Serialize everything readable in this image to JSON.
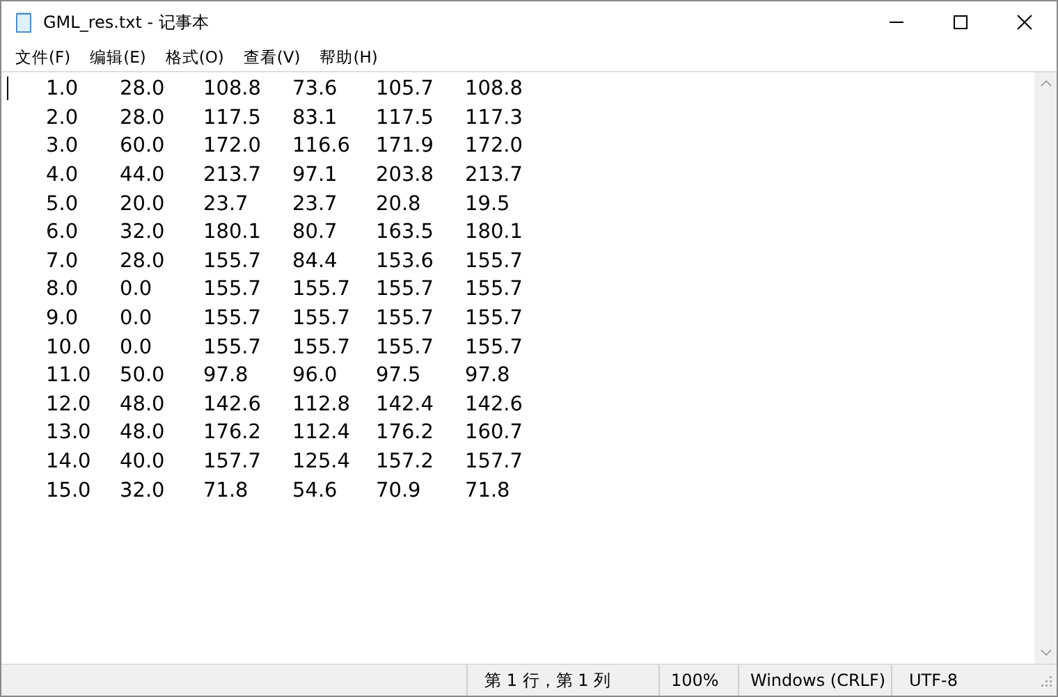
{
  "window": {
    "title": "GML_res.txt - 记事本"
  },
  "menu": [
    "文件(F)",
    "编辑(E)",
    "格式(O)",
    "查看(V)",
    "帮助(H)"
  ],
  "rows": [
    [
      "1.0",
      "28.0",
      "108.8",
      "73.6",
      "105.7",
      "108.8"
    ],
    [
      "2.0",
      "28.0",
      "117.5",
      "83.1",
      "117.5",
      "117.3"
    ],
    [
      "3.0",
      "60.0",
      "172.0",
      "116.6",
      "171.9",
      "172.0"
    ],
    [
      "4.0",
      "44.0",
      "213.7",
      "97.1",
      "203.8",
      "213.7"
    ],
    [
      "5.0",
      "20.0",
      "23.7",
      "23.7",
      "20.8",
      "19.5"
    ],
    [
      "6.0",
      "32.0",
      "180.1",
      "80.7",
      "163.5",
      "180.1"
    ],
    [
      "7.0",
      "28.0",
      "155.7",
      "84.4",
      "153.6",
      "155.7"
    ],
    [
      "8.0",
      "0.0",
      "155.7",
      "155.7",
      "155.7",
      "155.7"
    ],
    [
      "9.0",
      "0.0",
      "155.7",
      "155.7",
      "155.7",
      "155.7"
    ],
    [
      "10.0",
      "0.0",
      "155.7",
      "155.7",
      "155.7",
      "155.7"
    ],
    [
      "11.0",
      "50.0",
      "97.8",
      "96.0",
      "97.5",
      "97.8"
    ],
    [
      "12.0",
      "48.0",
      "142.6",
      "112.8",
      "142.4",
      "142.6"
    ],
    [
      "13.0",
      "48.0",
      "176.2",
      "112.4",
      "176.2",
      "160.7"
    ],
    [
      "14.0",
      "40.0",
      "157.7",
      "125.4",
      "157.2",
      "157.7"
    ],
    [
      "15.0",
      "32.0",
      "71.8",
      "54.6",
      "70.9",
      "71.8"
    ]
  ],
  "status_bar": {
    "position": "第 1 行，第 1 列",
    "zoom": "100%",
    "line_ending": "Windows (CRLF)",
    "encoding": "UTF-8"
  }
}
